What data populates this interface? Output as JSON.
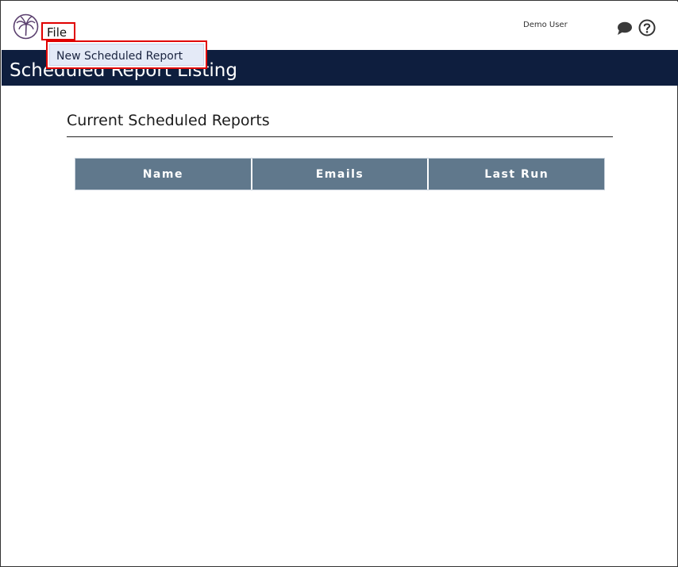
{
  "header": {
    "menu": {
      "file_label": "File"
    },
    "user": {
      "name": "Demo User"
    },
    "icons": {
      "logo": "palm-tree-logo",
      "chat": "chat-bubble-icon",
      "help": "help-circle-icon"
    }
  },
  "dropdown": {
    "items": [
      {
        "label": "New Scheduled Report"
      }
    ]
  },
  "page": {
    "title": "Scheduled Report Listing"
  },
  "section": {
    "title": "Current Scheduled Reports"
  },
  "table": {
    "columns": [
      "Name",
      "Emails",
      "Last Run"
    ],
    "rows": []
  },
  "colors": {
    "banner": "#0e1e3e",
    "table_header": "#60788c",
    "highlight": "#e00000",
    "logo": "#5a3f6e"
  }
}
